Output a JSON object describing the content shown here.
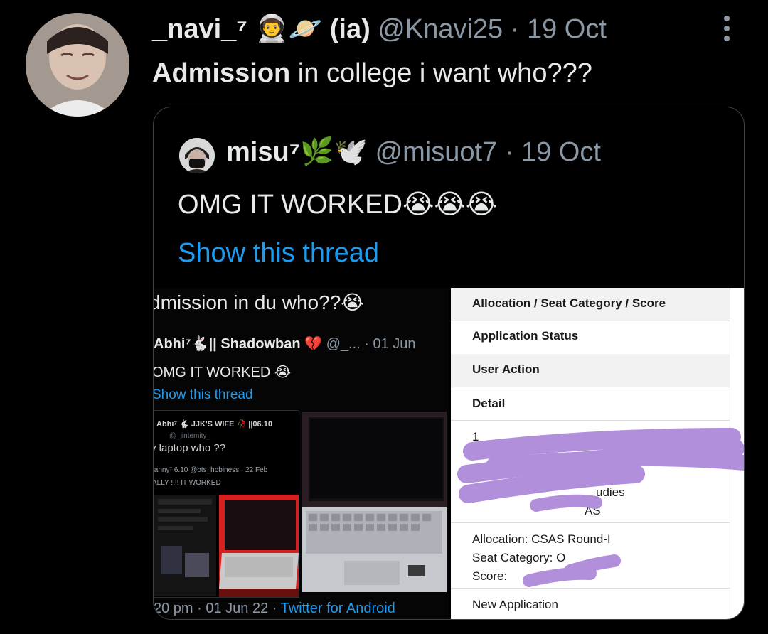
{
  "tweet": {
    "display_name": "_navi_⁷ 👨‍🚀🪐",
    "suffix": "(ia)",
    "handle_date": "@Knavi25 · 19 Oct",
    "text_bold": "Admission",
    "text_rest": " in college i want who???"
  },
  "quoted": {
    "display_name": "misu⁷🌿🕊️",
    "handle_date": "@misuot7 · 19 Oct",
    "text": "OMG IT WORKED😭😭😭",
    "show_thread": "Show this thread"
  },
  "screenshot_left": {
    "title": "dmission in du who??😭",
    "author_name": "Abhi⁷🐇|| Shadowban 💔",
    "author_meta": " @_... · 01 Jun",
    "text": "OMG IT WORKED 😭",
    "show_thread": "Show this thread",
    "inner_author": "Abhi⁷ 🐇 JJK'S WIFE 🥀 ||06.10",
    "inner_handle": "@_jintemity_",
    "inner_text": "v laptop who ??",
    "inner_line2": "tanny⁷ 6.10 @bts_hobiness · 22 Feb",
    "inner_line3": "ALLY !!!! IT WORKED",
    "footer_time": "20 pm · 01 Jun 22 · ",
    "footer_client": "Twitter for Android"
  },
  "screenshot_right": {
    "row1": "Allocation / Seat Category / Score",
    "row2": "Application Status",
    "row3": "User Action",
    "row4": "Detail",
    "row5": "1",
    "frag1": "udies",
    "frag2": "AS",
    "alloc": "Allocation: CSAS Round-I",
    "seat": "Seat Category: O",
    "score": "Score:",
    "new_app": "New Application"
  },
  "colors": {
    "background": "#000000",
    "link": "#1d9bf0",
    "muted": "#8b98a5",
    "redaction": "#b28fdb"
  },
  "icons": [
    "more-icon"
  ]
}
